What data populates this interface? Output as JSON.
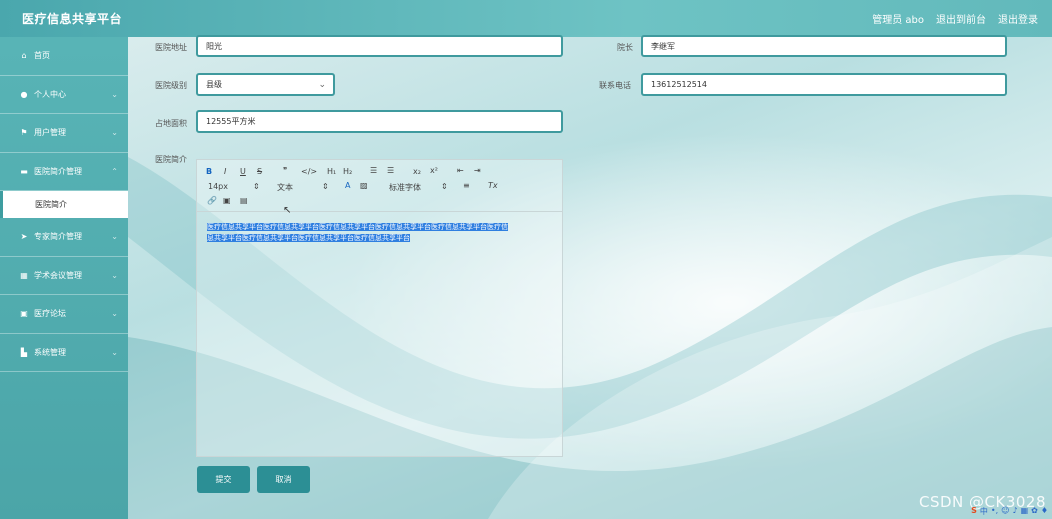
{
  "header": {
    "title": "医疗信息共享平台",
    "user": "管理员 abo",
    "back_to_front": "退出到前台",
    "logout": "退出登录"
  },
  "sidebar": {
    "items": [
      {
        "label": "首页",
        "icon": "home-icon"
      },
      {
        "label": "个人中心",
        "icon": "user-icon"
      },
      {
        "label": "用户管理",
        "icon": "flag-icon"
      },
      {
        "label": "医院简介管理",
        "icon": "monitor-icon"
      },
      {
        "label": "专家简介管理",
        "icon": "send-icon"
      },
      {
        "label": "学术会议管理",
        "icon": "grid-icon"
      },
      {
        "label": "医疗论坛",
        "icon": "clipboard-icon"
      },
      {
        "label": "系统管理",
        "icon": "briefcase-icon"
      }
    ],
    "submenu_active": "医院简介"
  },
  "form": {
    "address_label": "医院地址",
    "address_value": "阳光",
    "dean_label": "院长",
    "dean_value": "李继军",
    "level_label": "医院级别",
    "level_value": "县级",
    "phone_label": "联系电话",
    "phone_value": "13612512514",
    "area_label": "占地面积",
    "area_value": "12555平方米",
    "intro_label": "医院简介"
  },
  "editor": {
    "toolbar": {
      "font_size": "14px",
      "paragraph": "文本",
      "font_family": "标准字体"
    },
    "content_line1": "医疗信息共享平台医疗信息共享平台医疗信息共享平台医疗信息共享平台医疗信息共享平台医疗信",
    "content_line2": "息共享平台医疗信息共享平台医疗信息共享平台医疗信息共享平台"
  },
  "buttons": {
    "submit": "提交",
    "cancel": "取消"
  },
  "watermark": "CSDN @CK3028"
}
